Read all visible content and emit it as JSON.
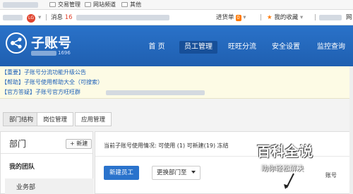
{
  "bookmarks": {
    "items": [
      {
        "label": "交易管理"
      },
      {
        "label": "网站频道"
      },
      {
        "label": "其他"
      }
    ]
  },
  "toolbar": {
    "lg_badge": "LG",
    "message_label": "消息",
    "message_count": "16",
    "pending_label": "进货单",
    "pending_count": "0",
    "favorites_label": "我的收藏",
    "tail_char": "网"
  },
  "header": {
    "logo_title": "子账号",
    "logo_sub": "1696",
    "nav": [
      {
        "label": "首 页"
      },
      {
        "label": "员工管理"
      },
      {
        "label": "旺旺分流"
      },
      {
        "label": "安全设置"
      },
      {
        "label": "监控查询"
      }
    ],
    "active_index": 1
  },
  "notices": [
    "【重要】子账号分流功能升级公告",
    "【帮助】子账号使用帮助大全（可搜索）",
    "【官方答疑】子账号官方旺旺群"
  ],
  "tabs": [
    {
      "label": "部门结构"
    },
    {
      "label": "岗位管理"
    },
    {
      "label": "应用管理"
    }
  ],
  "left_panel": {
    "title": "部门",
    "new_button": "+ 新建",
    "my_team": "我的团队",
    "sub_item": "业务部"
  },
  "right_panel": {
    "stats": "当前子账号使用情况:  可使用 (1)   可新建(19)   冻结",
    "new_employee": "新建员工",
    "change_dept": "更换部门至",
    "trail_text": "账号"
  },
  "watermark": {
    "title": "百科全说",
    "subtitle": "助你轻松解决"
  },
  "colors": {
    "header_blue": "#2a72c9",
    "active_nav": "#174f98",
    "link_blue": "#1c5fb8",
    "notice_bg": "#fdfbe5",
    "accent_orange": "#ff7a00",
    "badge_red": "#e0442e"
  }
}
